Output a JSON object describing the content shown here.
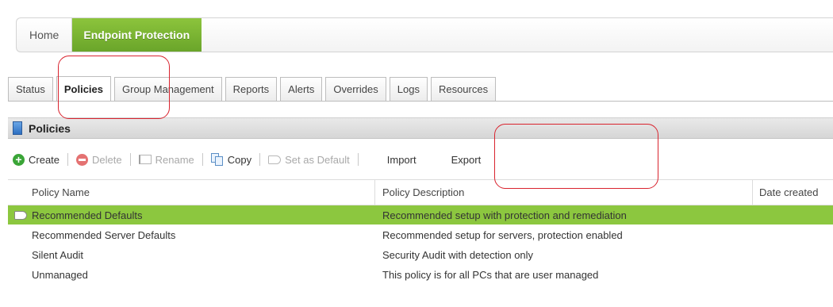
{
  "topnav": {
    "home": "Home",
    "active": "Endpoint Protection"
  },
  "tabs": [
    {
      "label": "Status"
    },
    {
      "label": "Policies"
    },
    {
      "label": "Group Management"
    },
    {
      "label": "Reports"
    },
    {
      "label": "Alerts"
    },
    {
      "label": "Overrides"
    },
    {
      "label": "Logs"
    },
    {
      "label": "Resources"
    }
  ],
  "panel": {
    "title": "Policies"
  },
  "toolbar": {
    "create": "Create",
    "delete": "Delete",
    "rename": "Rename",
    "copy": "Copy",
    "set_default": "Set as Default",
    "import": "Import",
    "export": "Export"
  },
  "table": {
    "columns": [
      "Policy Name",
      "Policy Description",
      "Date created"
    ],
    "rows": [
      {
        "name": "Recommended Defaults",
        "description": "Recommended setup with protection and remediation",
        "date": ""
      },
      {
        "name": "Recommended Server Defaults",
        "description": "Recommended setup for servers, protection enabled",
        "date": ""
      },
      {
        "name": "Silent Audit",
        "description": "Security Audit with detection only",
        "date": ""
      },
      {
        "name": "Unmanaged",
        "description": "This policy is for all PCs that are user managed",
        "date": ""
      }
    ]
  },
  "colors": {
    "accent_green": "#8cc73f",
    "highlight_red": "#d9232e",
    "panel_icon_blue": "#2d6fc1"
  }
}
